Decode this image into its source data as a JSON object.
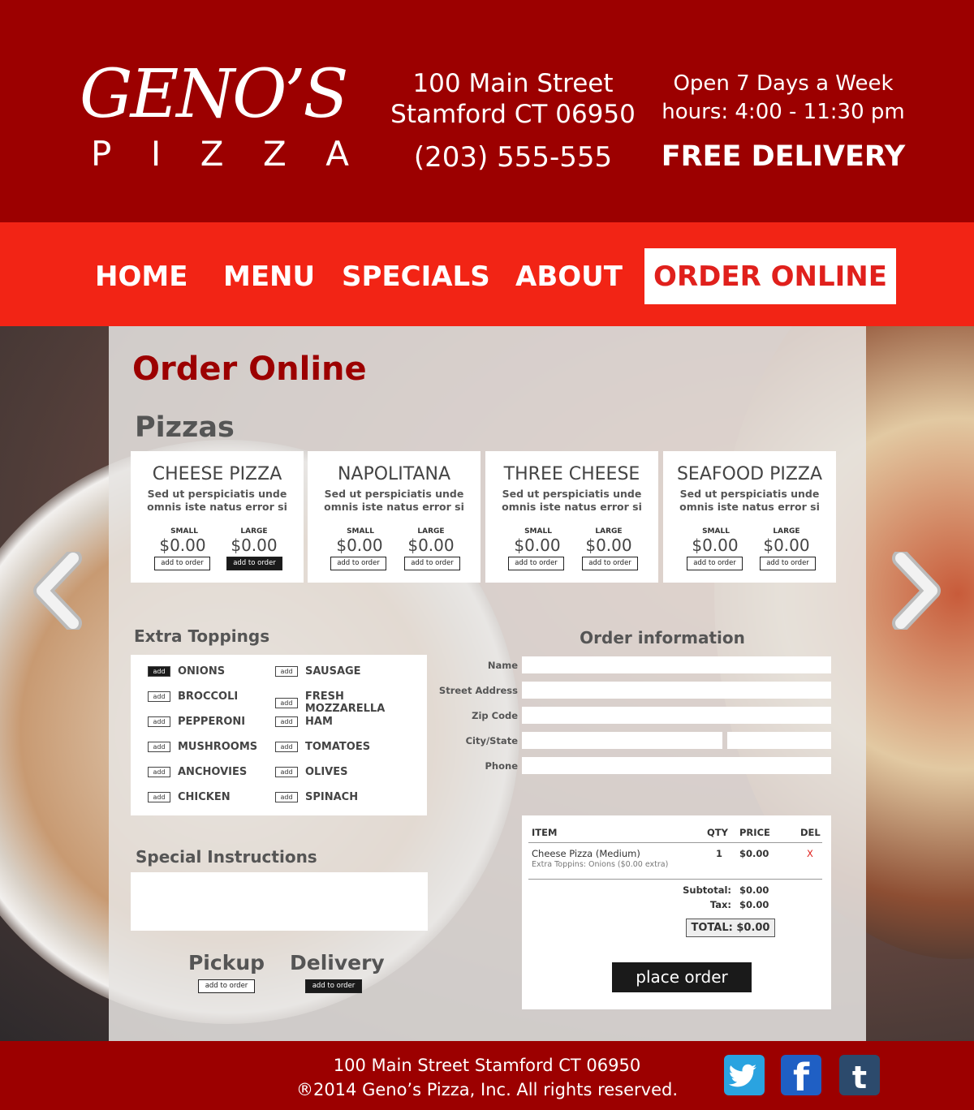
{
  "header": {
    "logo_main": "GENO’S",
    "logo_letters": [
      "P",
      "I",
      "Z",
      "Z",
      "A"
    ],
    "address_line1": "100 Main Street",
    "address_line2": "Stamford CT 06950",
    "phone": "(203) 555-555",
    "open_line": "Open 7 Days a Week",
    "hours_line": "hours: 4:00 - 11:30 pm",
    "free_delivery": "FREE DELIVERY"
  },
  "nav": {
    "items": [
      "HOME",
      "MENU",
      "SPECIALS",
      "ABOUT"
    ],
    "order_online": "ORDER ONLINE"
  },
  "page": {
    "title": "Order Online",
    "pizzas_heading": "Pizzas"
  },
  "pizzas": [
    {
      "name": "CHEESE PIZZA",
      "desc1": "Sed ut perspiciatis unde",
      "desc2": "omnis iste natus error si",
      "small_label": "SMALL",
      "large_label": "LARGE",
      "small_price": "$0.00",
      "large_price": "$0.00",
      "small_btn": "add to order",
      "large_btn": "add to order"
    },
    {
      "name": "NAPOLITANA",
      "desc1": "Sed ut perspiciatis unde",
      "desc2": "omnis iste natus error si",
      "small_label": "SMALL",
      "large_label": "LARGE",
      "small_price": "$0.00",
      "large_price": "$0.00",
      "small_btn": "add to order",
      "large_btn": "add to order"
    },
    {
      "name": "THREE CHEESE",
      "desc1": "Sed ut perspiciatis unde",
      "desc2": "omnis iste natus error si",
      "small_label": "SMALL",
      "large_label": "LARGE",
      "small_price": "$0.00",
      "large_price": "$0.00",
      "small_btn": "add to order",
      "large_btn": "add to order"
    },
    {
      "name": "SEAFOOD PIZZA",
      "desc1": "Sed ut perspiciatis unde",
      "desc2": "omnis iste natus error si",
      "small_label": "SMALL",
      "large_label": "LARGE",
      "small_price": "$0.00",
      "large_price": "$0.00",
      "small_btn": "add to order",
      "large_btn": "add to order"
    }
  ],
  "toppings": {
    "heading": "Extra Toppings",
    "add_label": "add",
    "items": [
      "ONIONS",
      "BROCCOLI",
      "PEPPERONI",
      "MUSHROOMS",
      "ANCHOVIES",
      "CHICKEN",
      "SAUSAGE",
      "FRESH MOZZARELLA",
      "HAM",
      "TOMATOES",
      "OLIVES",
      "SPINACH"
    ]
  },
  "instructions": {
    "heading": "Special Instructions"
  },
  "fulfillment": {
    "pickup": "Pickup",
    "delivery": "Delivery",
    "button": "add to order"
  },
  "order_info": {
    "heading": "Order information",
    "name": "Name",
    "street": "Street Address",
    "zip": "Zip Code",
    "city_state": "City/State",
    "phone": "Phone"
  },
  "summary": {
    "col_item": "ITEM",
    "col_qty": "QTY",
    "col_price": "PRICE",
    "col_del": "DEL",
    "item_name": "Cheese Pizza (Medium)",
    "item_extra": "Extra Toppins: Onions ($0.00 extra)",
    "item_qty": "1",
    "item_price": "$0.00",
    "item_del": "X",
    "subtotal_label": "Subtotal:",
    "subtotal": "$0.00",
    "tax_label": "Tax:",
    "tax": "$0.00",
    "total": "TOTAL:  $0.00",
    "place_order": "place order"
  },
  "footer": {
    "address": "100 Main Street Stamford CT 06950",
    "copyright": "®2014 Geno’s Pizza, Inc. All rights reserved."
  },
  "social": [
    "twitter-icon",
    "facebook-icon",
    "tumblr-icon"
  ],
  "colors": {
    "header_red": "#9c0000",
    "nav_red": "#f22415",
    "accent_red": "#e0201c"
  }
}
